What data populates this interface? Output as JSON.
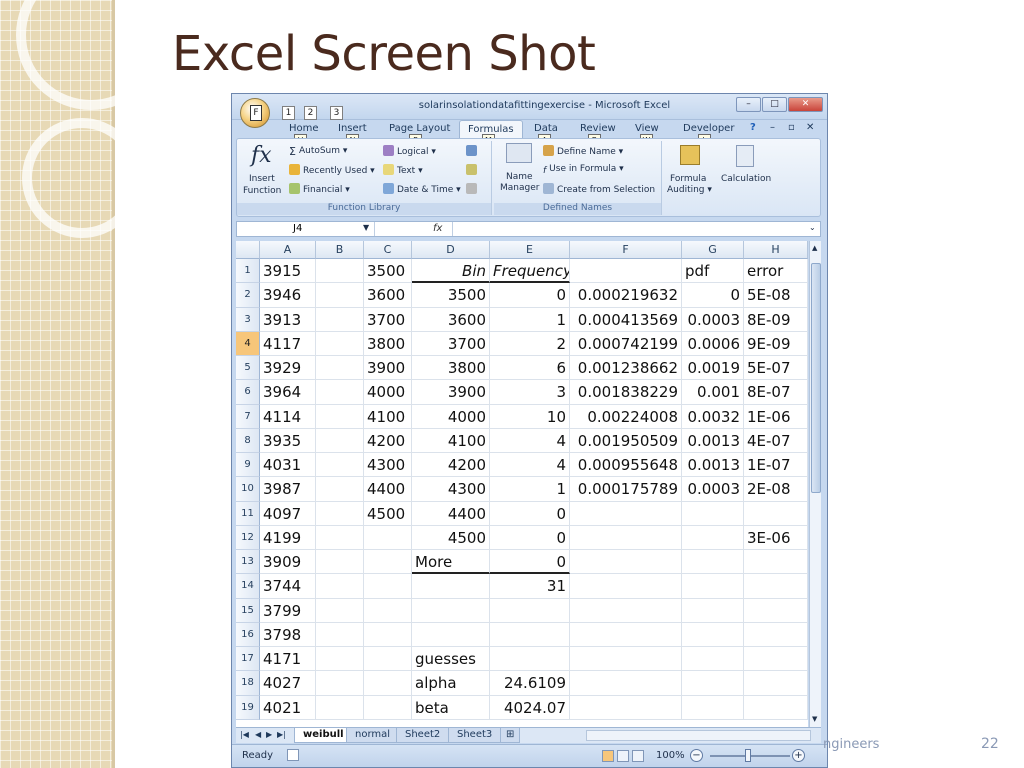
{
  "slide": {
    "title": "Excel Screen Shot",
    "footer_text": "ngineers",
    "page_number": "22"
  },
  "excel": {
    "window_title": "solarinsolationdatafittingexercise - Microsoft Excel",
    "office_button_key": "F",
    "qat_keys": [
      "1",
      "2",
      "3"
    ],
    "window_controls": {
      "minimize": "–",
      "restore": "□",
      "close": "✕"
    },
    "ribbon_tabs": [
      {
        "label": "Home",
        "keytip": "H"
      },
      {
        "label": "Insert",
        "keytip": "N"
      },
      {
        "label": "Page Layout",
        "keytip": "P"
      },
      {
        "label": "Formulas",
        "keytip": "M",
        "active": true
      },
      {
        "label": "Data",
        "keytip": "A"
      },
      {
        "label": "Review",
        "keytip": "R"
      },
      {
        "label": "View",
        "keytip": "W"
      },
      {
        "label": "Developer",
        "keytip": "L"
      }
    ],
    "ribbon": {
      "function_library": {
        "group_label": "Function Library",
        "insert_function_line1": "Insert",
        "insert_function_line2": "Function",
        "autosum": "AutoSum ▾",
        "recently_used": "Recently Used ▾",
        "financial": "Financial ▾",
        "logical": "Logical ▾",
        "text": "Text ▾",
        "date_time": "Date & Time ▾"
      },
      "defined_names": {
        "group_label": "Defined Names",
        "name_manager_line1": "Name",
        "name_manager_line2": "Manager",
        "define_name": "Define Name ▾",
        "use_in_formula": "Use in Formula ▾",
        "create_from_selection": "Create from Selection"
      },
      "formula_auditing_line1": "Formula",
      "formula_auditing_line2": "Auditing ▾",
      "calculation": "Calculation"
    },
    "name_box": "J4",
    "fx_label": "fx",
    "columns": [
      "A",
      "B",
      "C",
      "D",
      "E",
      "F",
      "G",
      "H"
    ],
    "rows": [
      {
        "n": "1",
        "A": "3915",
        "B": "",
        "C": "3500",
        "D": "Bin",
        "E": "Frequency",
        "F": "",
        "G": "pdf",
        "H": "error"
      },
      {
        "n": "2",
        "A": "3946",
        "B": "",
        "C": "3600",
        "D": "3500",
        "E": "0",
        "F": "0.000219632",
        "G": "0",
        "H": "5E-08"
      },
      {
        "n": "3",
        "A": "3913",
        "B": "",
        "C": "3700",
        "D": "3600",
        "E": "1",
        "F": "0.000413569",
        "G": "0.0003",
        "H": "8E-09"
      },
      {
        "n": "4",
        "A": "4117",
        "B": "",
        "C": "3800",
        "D": "3700",
        "E": "2",
        "F": "0.000742199",
        "G": "0.0006",
        "H": "9E-09"
      },
      {
        "n": "5",
        "A": "3929",
        "B": "",
        "C": "3900",
        "D": "3800",
        "E": "6",
        "F": "0.001238662",
        "G": "0.0019",
        "H": "5E-07"
      },
      {
        "n": "6",
        "A": "3964",
        "B": "",
        "C": "4000",
        "D": "3900",
        "E": "3",
        "F": "0.001838229",
        "G": "0.001",
        "H": "8E-07"
      },
      {
        "n": "7",
        "A": "4114",
        "B": "",
        "C": "4100",
        "D": "4000",
        "E": "10",
        "F": "0.00224008",
        "G": "0.0032",
        "H": "1E-06"
      },
      {
        "n": "8",
        "A": "3935",
        "B": "",
        "C": "4200",
        "D": "4100",
        "E": "4",
        "F": "0.001950509",
        "G": "0.0013",
        "H": "4E-07"
      },
      {
        "n": "9",
        "A": "4031",
        "B": "",
        "C": "4300",
        "D": "4200",
        "E": "4",
        "F": "0.000955648",
        "G": "0.0013",
        "H": "1E-07"
      },
      {
        "n": "10",
        "A": "3987",
        "B": "",
        "C": "4400",
        "D": "4300",
        "E": "1",
        "F": "0.000175789",
        "G": "0.0003",
        "H": "2E-08"
      },
      {
        "n": "11",
        "A": "4097",
        "B": "",
        "C": "4500",
        "D": "4400",
        "E": "0",
        "F": "",
        "G": "",
        "H": ""
      },
      {
        "n": "12",
        "A": "4199",
        "B": "",
        "C": "",
        "D": "4500",
        "E": "0",
        "F": "",
        "G": "",
        "H": "3E-06"
      },
      {
        "n": "13",
        "A": "3909",
        "B": "",
        "C": "",
        "D": "More",
        "E": "0",
        "F": "",
        "G": "",
        "H": ""
      },
      {
        "n": "14",
        "A": "3744",
        "B": "",
        "C": "",
        "D": "",
        "E": "31",
        "F": "",
        "G": "",
        "H": ""
      },
      {
        "n": "15",
        "A": "3799",
        "B": "",
        "C": "",
        "D": "",
        "E": "",
        "F": "",
        "G": "",
        "H": ""
      },
      {
        "n": "16",
        "A": "3798",
        "B": "",
        "C": "",
        "D": "",
        "E": "",
        "F": "",
        "G": "",
        "H": ""
      },
      {
        "n": "17",
        "A": "4171",
        "B": "",
        "C": "",
        "D": "guesses",
        "E": "",
        "F": "",
        "G": "",
        "H": ""
      },
      {
        "n": "18",
        "A": "4027",
        "B": "",
        "C": "",
        "D": "alpha",
        "E": "24.6109",
        "F": "",
        "G": "",
        "H": ""
      },
      {
        "n": "19",
        "A": "4021",
        "B": "",
        "C": "",
        "D": "beta",
        "E": "4024.07",
        "F": "",
        "G": "",
        "H": ""
      }
    ],
    "selected_row": "4",
    "sheet_tabs": [
      {
        "label": "weibull",
        "active": true
      },
      {
        "label": "normal"
      },
      {
        "label": "Sheet2"
      },
      {
        "label": "Sheet3"
      }
    ],
    "status": {
      "ready": "Ready",
      "zoom": "100%",
      "zoom_minus": "−",
      "zoom_plus": "+"
    },
    "colors": {
      "title_brown": "#4a2a1e",
      "ribbon_blue": "#c6d8ef",
      "selected_row_header": "#f7c67a"
    }
  }
}
